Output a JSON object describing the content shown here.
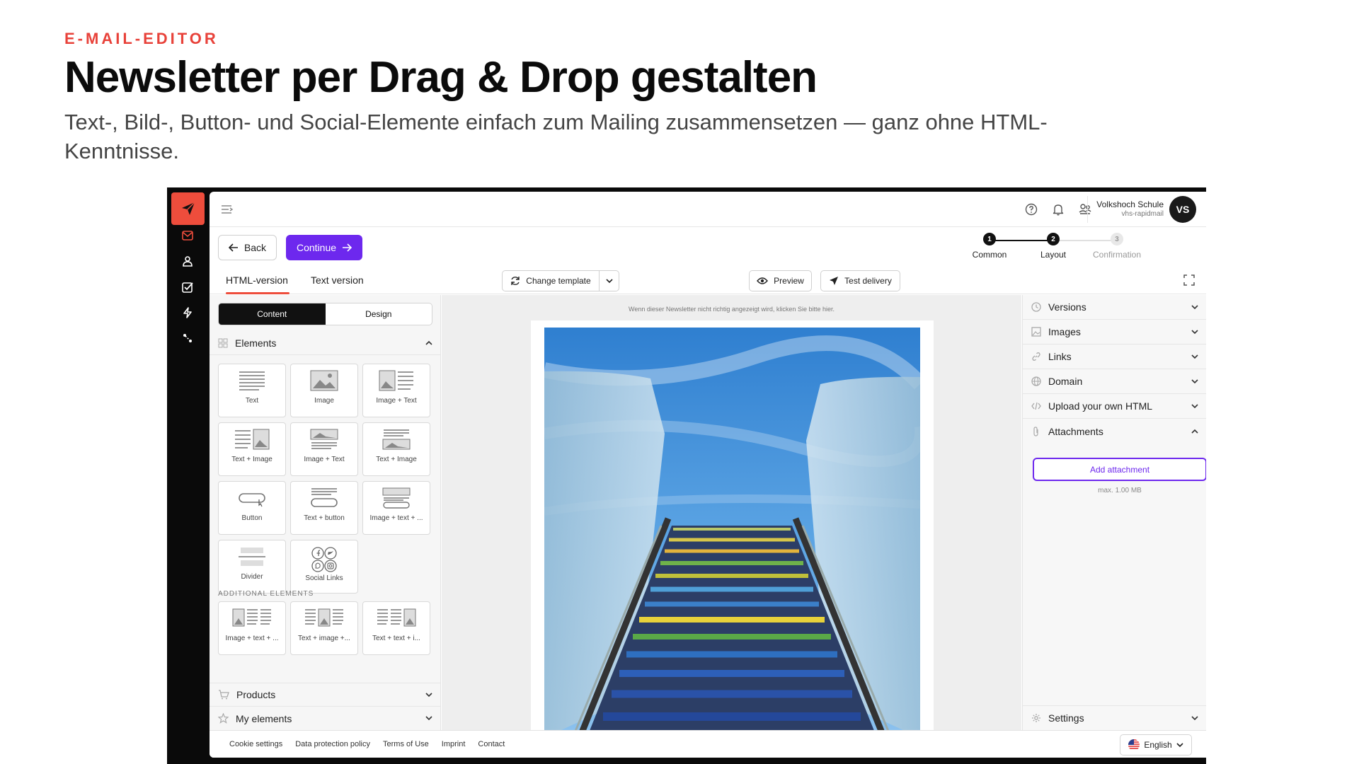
{
  "hero": {
    "eyebrow": "E-MAIL-EDITOR",
    "title": "Newsletter per Drag & Drop gestalten",
    "subtitle": "Text-, Bild-, Button- und Social-Elemente einfach zum Mailing zusammensetzen — ganz ohne HTML-Kenntnisse."
  },
  "colors": {
    "brand": "#ee4d3c",
    "accent": "#6d28ee",
    "rail": "#0a0a0a"
  },
  "rail": {
    "icons": [
      "send-logo-icon",
      "mail-icon",
      "contacts-icon",
      "checklist-icon",
      "automation-icon",
      "integrations-icon"
    ]
  },
  "user": {
    "name": "Volkshoch Schule",
    "account": "vhs-rapidmail",
    "initials": "VS"
  },
  "actions": {
    "back": "Back",
    "continue": "Continue"
  },
  "stepper": [
    {
      "num": "1",
      "label": "Common",
      "state": "done"
    },
    {
      "num": "2",
      "label": "Layout",
      "state": "current"
    },
    {
      "num": "3",
      "label": "Confirmation",
      "state": "upcoming"
    }
  ],
  "tabs": {
    "html": "HTML-version",
    "text": "Text version"
  },
  "toolbar": {
    "change_template": "Change template",
    "preview": "Preview",
    "test_delivery": "Test delivery"
  },
  "left": {
    "segment": {
      "content": "Content",
      "design": "Design"
    },
    "elements_title": "Elements",
    "elements": [
      "Text",
      "Image",
      "Image + Text",
      "Text + Image",
      "Image + Text",
      "Text + Image",
      "Button",
      "Text + button",
      "Image + text + ...",
      "Divider",
      "Social Links"
    ],
    "additional_title": "ADDITIONAL ELEMENTS",
    "additional": [
      "Image + text + ...",
      "Text + image +...",
      "Text + text + i..."
    ],
    "products": "Products",
    "my_elements": "My elements"
  },
  "canvas": {
    "note": "Wenn dieser Newsletter nicht richtig angezeigt wird, klicken Sie bitte hier."
  },
  "right": {
    "sections": [
      "Versions",
      "Images",
      "Links",
      "Domain",
      "Upload your own HTML",
      "Attachments"
    ],
    "add_attachment": "Add attachment",
    "max_size": "max. 1.00 MB",
    "settings": "Settings"
  },
  "footer": {
    "links": [
      "Cookie settings",
      "Data protection policy",
      "Terms of Use",
      "Imprint",
      "Contact"
    ],
    "language": "English"
  }
}
